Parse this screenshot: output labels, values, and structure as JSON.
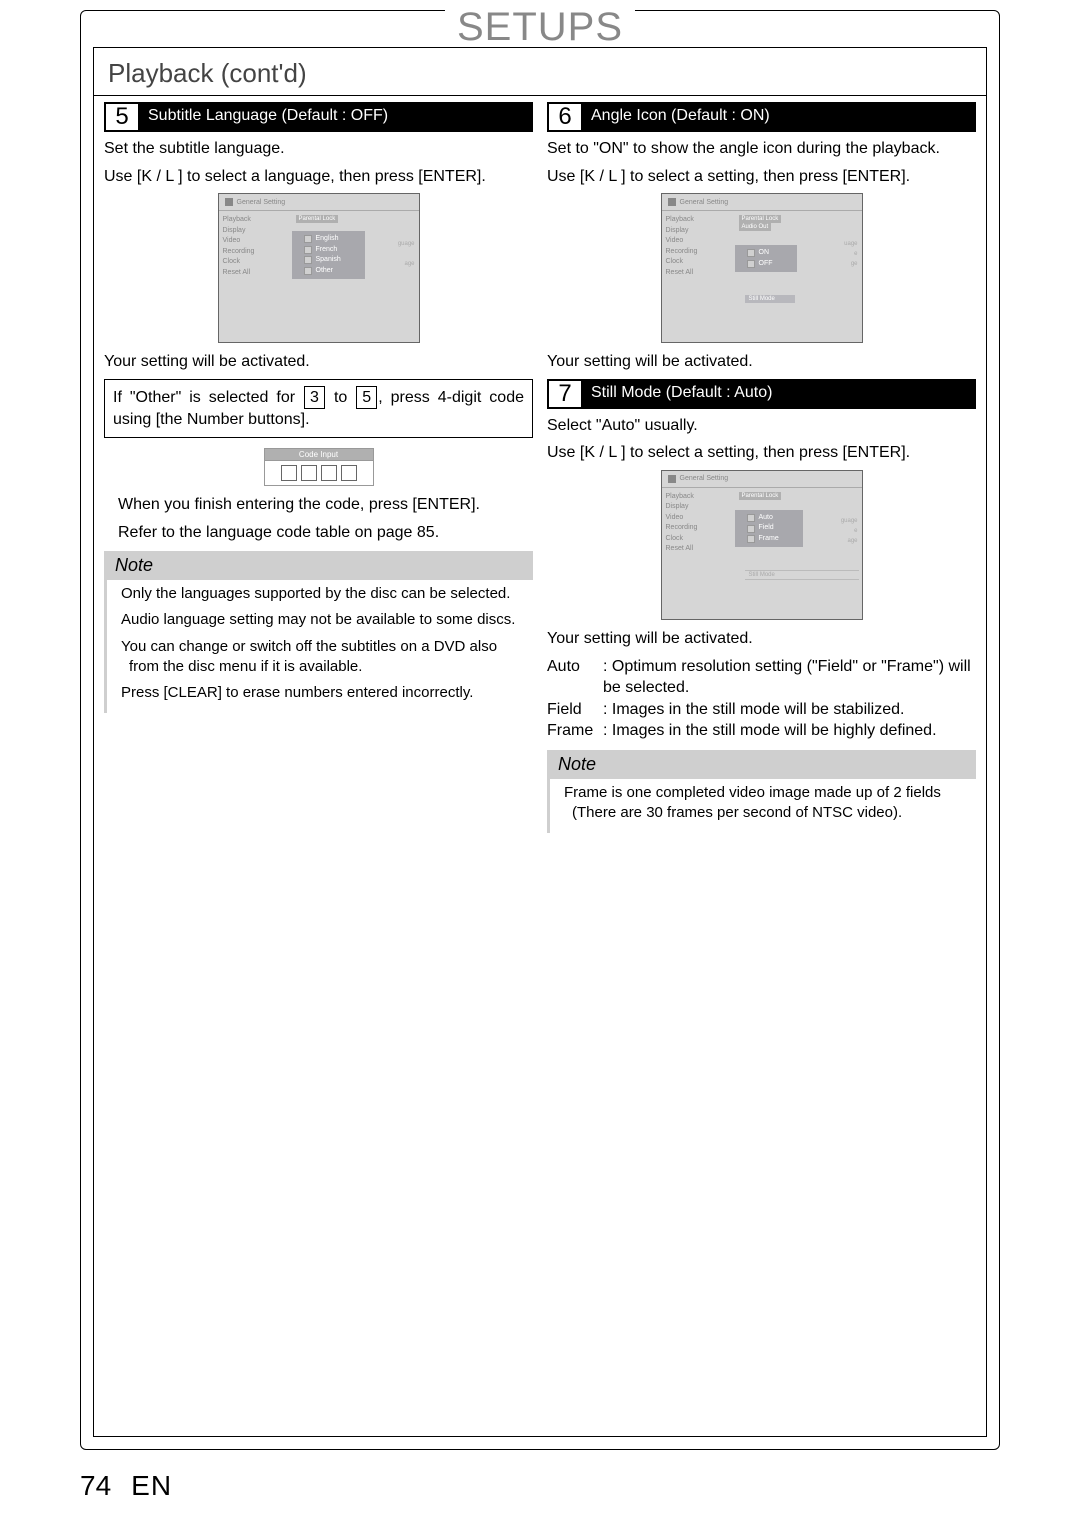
{
  "header": {
    "title": "SETUPS",
    "section": "Playback (cont'd)"
  },
  "footer": {
    "page": "74",
    "lang": "EN"
  },
  "step5": {
    "num": "5",
    "title": "Subtitle Language (Default : OFF)",
    "line1": "Set the subtitle language.",
    "line2": "Use [K / L ] to select a language, then press [ENTER].",
    "activated": "Your setting will be activated.",
    "callout_a": "If \"Other\" is selected for ",
    "callout_b": " to ",
    "callout_c": ", press 4-digit code using [the Number buttons].",
    "n3": "3",
    "n5": "5",
    "code_label": "Code Input",
    "after_code1": "When you finish entering the code, press [ENTER].",
    "after_code2": "Refer to the language code table on page 85.",
    "note_title": "Note",
    "note_items": {
      "a": "Only the languages supported by the disc can be selected.",
      "b": "Audio language setting may not be available to some discs.",
      "c": "You can change or switch off the subtitles on a DVD also from the disc menu if it is available.",
      "d": "Press [CLEAR] to erase numbers entered incorrectly."
    },
    "osd": {
      "header": "General Setting",
      "side": [
        "Playback",
        "Display",
        "Video",
        "Recording",
        "Clock",
        "Reset All"
      ],
      "tab": "Parental Lock",
      "options": [
        "English",
        "French",
        "Spanish",
        "Other"
      ],
      "tag1": "guage",
      "tag2": "age"
    }
  },
  "step6": {
    "num": "6",
    "title": "Angle Icon (Default : ON)",
    "line1": "Set to \"ON\" to show the angle icon during the playback.",
    "line2": "Use [K / L ] to select a setting, then press [ENTER].",
    "activated": "Your setting will be activated.",
    "osd": {
      "header": "General Setting",
      "side": [
        "Playback",
        "Display",
        "Video",
        "Recording",
        "Clock",
        "Reset All"
      ],
      "tab1": "Parental Lock",
      "tab2": "Audio Out",
      "options": [
        "ON",
        "OFF"
      ],
      "bottom": "Still Mode",
      "tag1": "uage",
      "tag2": "e",
      "tag3": "ge"
    }
  },
  "step7": {
    "num": "7",
    "title": "Still Mode (Default : Auto)",
    "line1": "Select \"Auto\" usually.",
    "line2": "Use [K / L ] to select a setting, then press [ENTER].",
    "activated": "Your setting will be activated.",
    "defs": {
      "auto_k": "Auto",
      "auto_v": ": Optimum resolution setting (\"Field\" or \"Frame\") will be selected.",
      "field_k": "Field",
      "field_v": ": Images in the still mode will be stabilized.",
      "frame_k": "Frame",
      "frame_v": ": Images in the still mode will be highly defined."
    },
    "note_title": "Note",
    "note_body": "Frame is one completed video image made up of 2 fields (There are 30 frames per second of NTSC video).",
    "osd": {
      "header": "General Setting",
      "side": [
        "Playback",
        "Display",
        "Video",
        "Recording",
        "Clock",
        "Reset All"
      ],
      "tab": "Parental Lock",
      "options": [
        "Auto",
        "Field",
        "Frame"
      ],
      "bottom": "Still Mode",
      "tag1": "guage",
      "tag2": "e",
      "tag3": "age"
    }
  }
}
